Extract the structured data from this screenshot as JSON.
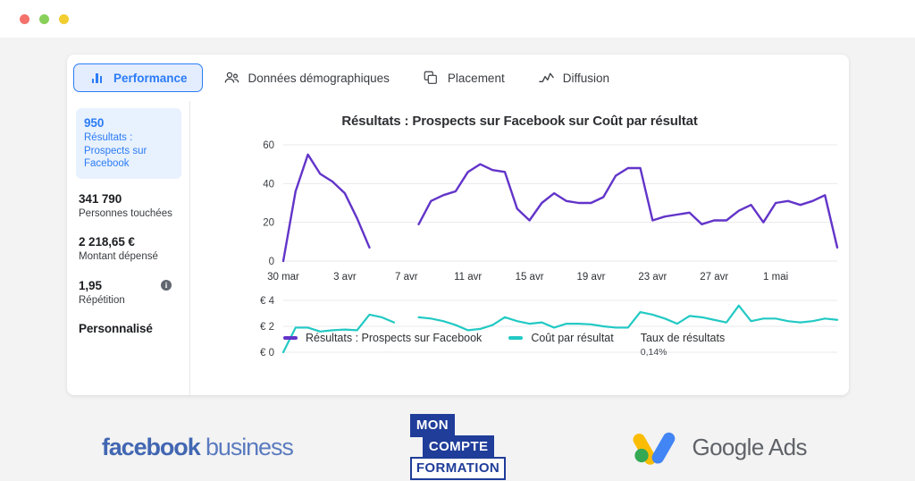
{
  "window": {
    "buttons": [
      {
        "name": "close",
        "color": "#f4716c"
      },
      {
        "name": "minimize",
        "color": "#89d05a"
      },
      {
        "name": "maximize",
        "color": "#f2ce31"
      }
    ]
  },
  "tabs": [
    {
      "label": "Performance",
      "icon": "bar-chart-icon",
      "active": true
    },
    {
      "label": "Données démographiques",
      "icon": "people-icon",
      "active": false
    },
    {
      "label": "Placement",
      "icon": "layers-icon",
      "active": false
    },
    {
      "label": "Diffusion",
      "icon": "line-chart-icon",
      "active": false
    }
  ],
  "sidebar": {
    "metrics": [
      {
        "value": "950",
        "label": "Résultats : Prospects sur Facebook",
        "highlight": true,
        "info": false
      },
      {
        "value": "341 790",
        "label": "Personnes touchées",
        "highlight": false,
        "info": false
      },
      {
        "value": "2 218,65 €",
        "label": "Montant dépensé",
        "highlight": false,
        "info": false
      },
      {
        "value": "1,95",
        "label": "Répétition",
        "highlight": false,
        "info": true
      }
    ],
    "custom_label": "Personnalisé"
  },
  "chart_data": {
    "type": "line",
    "title": "Résultats : Prospects sur Facebook sur Coût par résultat",
    "xlabel": "",
    "grid": true,
    "legend_position": "bottom",
    "x_tick_labels": [
      "30 mar",
      "3 avr",
      "7 avr",
      "11 avr",
      "15 avr",
      "19 avr",
      "23 avr",
      "27 avr",
      "1 mai"
    ],
    "x_domain": [
      "30 mar",
      "2 mai"
    ],
    "panels": [
      {
        "name": "results-panel",
        "ylabel": "",
        "ylim": [
          0,
          60
        ],
        "yticks": [
          0,
          20,
          40,
          60
        ],
        "ytick_labels": [
          "0",
          "20",
          "40",
          "60"
        ],
        "series": [
          {
            "name": "Résultats : Prospects sur Facebook",
            "color": "#6234c9",
            "points": [
              {
                "x": 0,
                "y": 0
              },
              {
                "x": 1,
                "y": 36
              },
              {
                "x": 2,
                "y": 55
              },
              {
                "x": 3,
                "y": 45
              },
              {
                "x": 4,
                "y": 41
              },
              {
                "x": 5,
                "y": 35
              },
              {
                "x": 6,
                "y": 22
              },
              {
                "x": 7,
                "y": 7
              },
              {
                "x": 11,
                "y": 19
              },
              {
                "x": 12,
                "y": 31
              },
              {
                "x": 13,
                "y": 34
              },
              {
                "x": 14,
                "y": 36
              },
              {
                "x": 15,
                "y": 46
              },
              {
                "x": 16,
                "y": 50
              },
              {
                "x": 17,
                "y": 47
              },
              {
                "x": 18,
                "y": 46
              },
              {
                "x": 19,
                "y": 27
              },
              {
                "x": 20,
                "y": 21
              },
              {
                "x": 21,
                "y": 30
              },
              {
                "x": 22,
                "y": 35
              },
              {
                "x": 23,
                "y": 31
              },
              {
                "x": 24,
                "y": 30
              },
              {
                "x": 25,
                "y": 30
              },
              {
                "x": 26,
                "y": 33
              },
              {
                "x": 27,
                "y": 44
              },
              {
                "x": 28,
                "y": 48
              },
              {
                "x": 29,
                "y": 48
              },
              {
                "x": 30,
                "y": 21
              },
              {
                "x": 31,
                "y": 23
              },
              {
                "x": 32,
                "y": 24
              },
              {
                "x": 33,
                "y": 25
              },
              {
                "x": 34,
                "y": 19
              },
              {
                "x": 35,
                "y": 21
              },
              {
                "x": 36,
                "y": 21
              },
              {
                "x": 37,
                "y": 26
              },
              {
                "x": 38,
                "y": 29
              },
              {
                "x": 39,
                "y": 20
              },
              {
                "x": 40,
                "y": 30
              },
              {
                "x": 41,
                "y": 31
              },
              {
                "x": 42,
                "y": 29
              },
              {
                "x": 43,
                "y": 31
              },
              {
                "x": 44,
                "y": 34
              },
              {
                "x": 45,
                "y": 7
              }
            ]
          }
        ]
      },
      {
        "name": "cost-panel",
        "ylabel": "",
        "ylim": [
          0,
          4
        ],
        "yticks": [
          0,
          2,
          4
        ],
        "ytick_labels": [
          "€ 0",
          "€ 2",
          "€ 4"
        ],
        "series": [
          {
            "name": "Coût par résultat",
            "color": "#22c9c4",
            "points": [
              {
                "x": 0,
                "y": 0.0
              },
              {
                "x": 1,
                "y": 1.9
              },
              {
                "x": 2,
                "y": 1.9
              },
              {
                "x": 3,
                "y": 1.6
              },
              {
                "x": 4,
                "y": 1.7
              },
              {
                "x": 5,
                "y": 1.75
              },
              {
                "x": 6,
                "y": 1.7
              },
              {
                "x": 7,
                "y": 2.9
              },
              {
                "x": 8,
                "y": 2.7
              },
              {
                "x": 9,
                "y": 2.3
              },
              {
                "x": 11,
                "y": 2.7
              },
              {
                "x": 12,
                "y": 2.6
              },
              {
                "x": 13,
                "y": 2.4
              },
              {
                "x": 14,
                "y": 2.1
              },
              {
                "x": 15,
                "y": 1.7
              },
              {
                "x": 16,
                "y": 1.8
              },
              {
                "x": 17,
                "y": 2.1
              },
              {
                "x": 18,
                "y": 2.7
              },
              {
                "x": 19,
                "y": 2.4
              },
              {
                "x": 20,
                "y": 2.2
              },
              {
                "x": 21,
                "y": 2.3
              },
              {
                "x": 22,
                "y": 1.9
              },
              {
                "x": 23,
                "y": 2.2
              },
              {
                "x": 24,
                "y": 2.2
              },
              {
                "x": 25,
                "y": 2.15
              },
              {
                "x": 26,
                "y": 2.0
              },
              {
                "x": 27,
                "y": 1.9
              },
              {
                "x": 28,
                "y": 1.9
              },
              {
                "x": 29,
                "y": 3.1
              },
              {
                "x": 30,
                "y": 2.9
              },
              {
                "x": 31,
                "y": 2.6
              },
              {
                "x": 32,
                "y": 2.2
              },
              {
                "x": 33,
                "y": 2.8
              },
              {
                "x": 34,
                "y": 2.7
              },
              {
                "x": 35,
                "y": 2.5
              },
              {
                "x": 36,
                "y": 2.3
              },
              {
                "x": 37,
                "y": 3.6
              },
              {
                "x": 38,
                "y": 2.4
              },
              {
                "x": 39,
                "y": 2.6
              },
              {
                "x": 40,
                "y": 2.6
              },
              {
                "x": 41,
                "y": 2.4
              },
              {
                "x": 42,
                "y": 2.3
              },
              {
                "x": 43,
                "y": 2.4
              },
              {
                "x": 44,
                "y": 2.6
              },
              {
                "x": 45,
                "y": 2.5
              }
            ]
          }
        ]
      }
    ],
    "legend": [
      {
        "label": "Résultats : Prospects sur Facebook",
        "color": "#6234c9"
      },
      {
        "label": "Coût par résultat",
        "color": "#22c9c4"
      }
    ],
    "stat": {
      "title": "Taux de résultats",
      "value": "0,14%"
    }
  },
  "footer": {
    "logos": [
      {
        "name": "facebook-business-logo",
        "bold_part": "facebook",
        "regular_part": " business"
      },
      {
        "name": "mon-compte-formation-logo",
        "line1": "MON",
        "line2": "COMPTE",
        "line3": "FORMATION"
      },
      {
        "name": "google-ads-logo",
        "text": "Google Ads"
      }
    ]
  }
}
